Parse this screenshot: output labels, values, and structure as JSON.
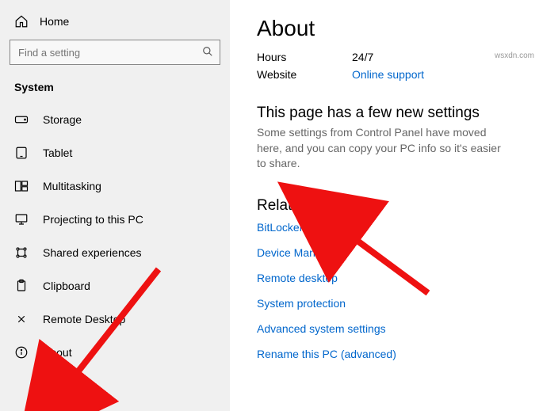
{
  "sidebar": {
    "home_label": "Home",
    "search_placeholder": "Find a setting",
    "category_label": "System",
    "items": [
      {
        "label": "Storage"
      },
      {
        "label": "Tablet"
      },
      {
        "label": "Multitasking"
      },
      {
        "label": "Projecting to this PC"
      },
      {
        "label": "Shared experiences"
      },
      {
        "label": "Clipboard"
      },
      {
        "label": "Remote Desktop"
      },
      {
        "label": "About"
      }
    ]
  },
  "content": {
    "page_title": "About",
    "support": {
      "hours_label": "Hours",
      "hours_value": "24/7",
      "website_label": "Website",
      "website_link": "Online support"
    },
    "newsettings": {
      "title": "This page has a few new settings",
      "desc": "Some settings from Control Panel have moved here, and you can copy your PC info so it's easier to share."
    },
    "related": {
      "title": "Related settings",
      "links": [
        "BitLocker settings",
        "Device Manager",
        "Remote desktop",
        "System protection",
        "Advanced system settings",
        "Rename this PC (advanced)"
      ]
    }
  },
  "watermark": "wsxdn.com"
}
